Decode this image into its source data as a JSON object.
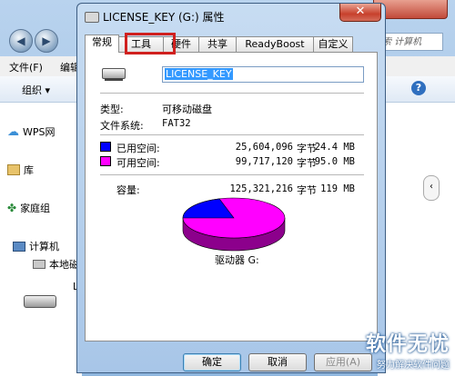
{
  "explorer": {
    "search_placeholder": "搜索 计算机",
    "menu": [
      "文件(F)",
      "编辑"
    ],
    "organize_label": "组织 ▾",
    "nav_items": [
      {
        "icon": "cloud-icon",
        "label": "WPS网"
      },
      {
        "icon": "library-icon",
        "label": "库"
      },
      {
        "icon": "homegroup-icon",
        "label": "家庭组"
      },
      {
        "icon": "computer-icon",
        "label": "计算机"
      },
      {
        "icon": "local-disk-icon",
        "label": "本地磁"
      }
    ],
    "truncated_item": "L"
  },
  "dialog": {
    "title": "LICENSE_KEY (G:) 属性",
    "close_label": "✕",
    "tabs": [
      "常规",
      "工具",
      "硬件",
      "共享",
      "ReadyBoost",
      "自定义"
    ],
    "active_tab": "常规",
    "highlighted_tab": "工具",
    "volume_name": "LICENSE_KEY",
    "type_label": "类型:",
    "type_value": "可移动磁盘",
    "fs_label": "文件系统:",
    "fs_value": "FAT32",
    "used": {
      "label": "已用空间:",
      "bytes": "25,604,096",
      "unit": "字节",
      "size": "24.4 MB",
      "color": "#0000ff"
    },
    "free": {
      "label": "可用空间:",
      "bytes": "99,717,120",
      "unit": "字节",
      "size": "95.0 MB",
      "color": "#ff00ff"
    },
    "capacity": {
      "label": "容量:",
      "bytes": "125,321,216",
      "unit": "字节",
      "size": "119 MB"
    },
    "drive_label": "驱动器 G:",
    "buttons": {
      "ok": "确定",
      "cancel": "取消",
      "apply": "应用(A)"
    }
  },
  "watermark": {
    "main": "软件无忧",
    "sub": "努力解决软件问题"
  }
}
